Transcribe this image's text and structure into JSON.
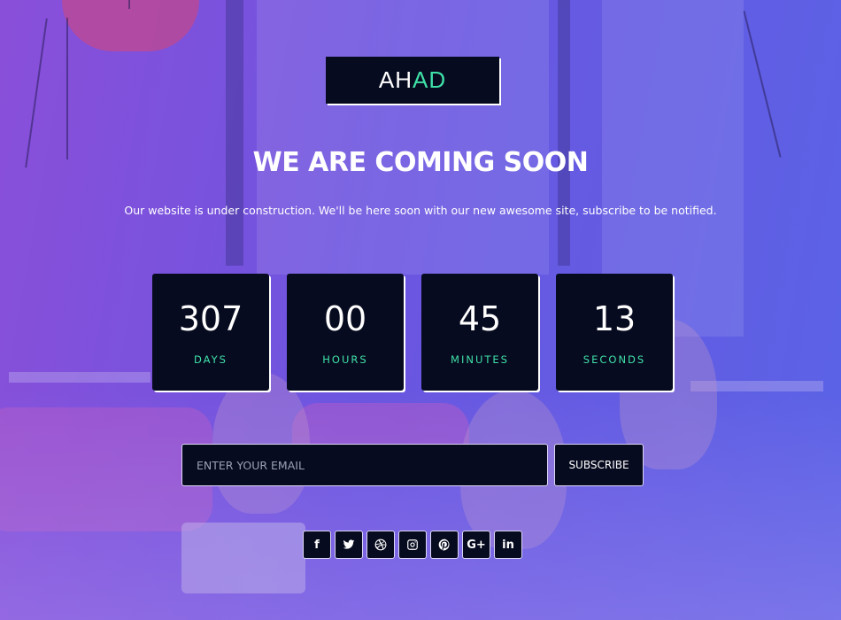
{
  "brand": {
    "part1": "AH",
    "part2": "AD",
    "accent_color": "#3fe0a8",
    "box_color": "#070b1f"
  },
  "hero": {
    "title": "WE ARE COMING SOON",
    "subtitle": "Our website is under construction. We'll be here soon with our new awesome site, subscribe to be notified."
  },
  "countdown": [
    {
      "value": "307",
      "label": "DAYS"
    },
    {
      "value": "00",
      "label": "HOURS"
    },
    {
      "value": "45",
      "label": "MINUTES"
    },
    {
      "value": "13",
      "label": "SECONDS"
    }
  ],
  "subscribe": {
    "placeholder": "ENTER YOUR EMAIL",
    "button_label": "SUBSCRIBE"
  },
  "social": [
    {
      "icon": "facebook-icon",
      "glyph": "f"
    },
    {
      "icon": "twitter-icon"
    },
    {
      "icon": "dribbble-icon"
    },
    {
      "icon": "instagram-icon"
    },
    {
      "icon": "pinterest-icon"
    },
    {
      "icon": "google-plus-icon",
      "glyph": "G+"
    },
    {
      "icon": "linkedin-icon",
      "glyph": "in"
    }
  ]
}
